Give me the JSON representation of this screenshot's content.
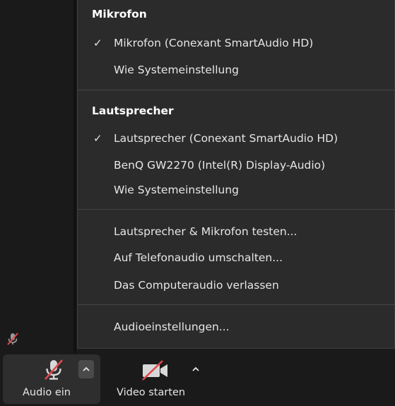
{
  "microphone": {
    "title": "Mikrofon",
    "items": [
      {
        "label": "Mikrofon (Conexant SmartAudio HD)",
        "checked": true
      },
      {
        "label": "Wie Systemeinstellung",
        "checked": false
      }
    ]
  },
  "speaker": {
    "title": "Lautsprecher",
    "items": [
      {
        "label": "Lautsprecher (Conexant SmartAudio HD)",
        "checked": true
      },
      {
        "label": "BenQ GW2270 (Intel(R) Display-Audio)",
        "checked": false
      },
      {
        "label": "Wie Systemeinstellung",
        "checked": false
      }
    ]
  },
  "actions": {
    "test": "Lautsprecher & Mikrofon testen...",
    "phone": "Auf Telefonaudio umschalten...",
    "leave": "Das Computeraudio verlassen"
  },
  "settings": {
    "label": "Audioeinstellungen..."
  },
  "check_glyph": "✓",
  "toolbar": {
    "audio_label": "Audio ein",
    "video_label": "Video starten"
  },
  "colors": {
    "menu_bg": "#2b2b2b",
    "muted_red": "#e0484c",
    "text": "#e6e6e6"
  }
}
